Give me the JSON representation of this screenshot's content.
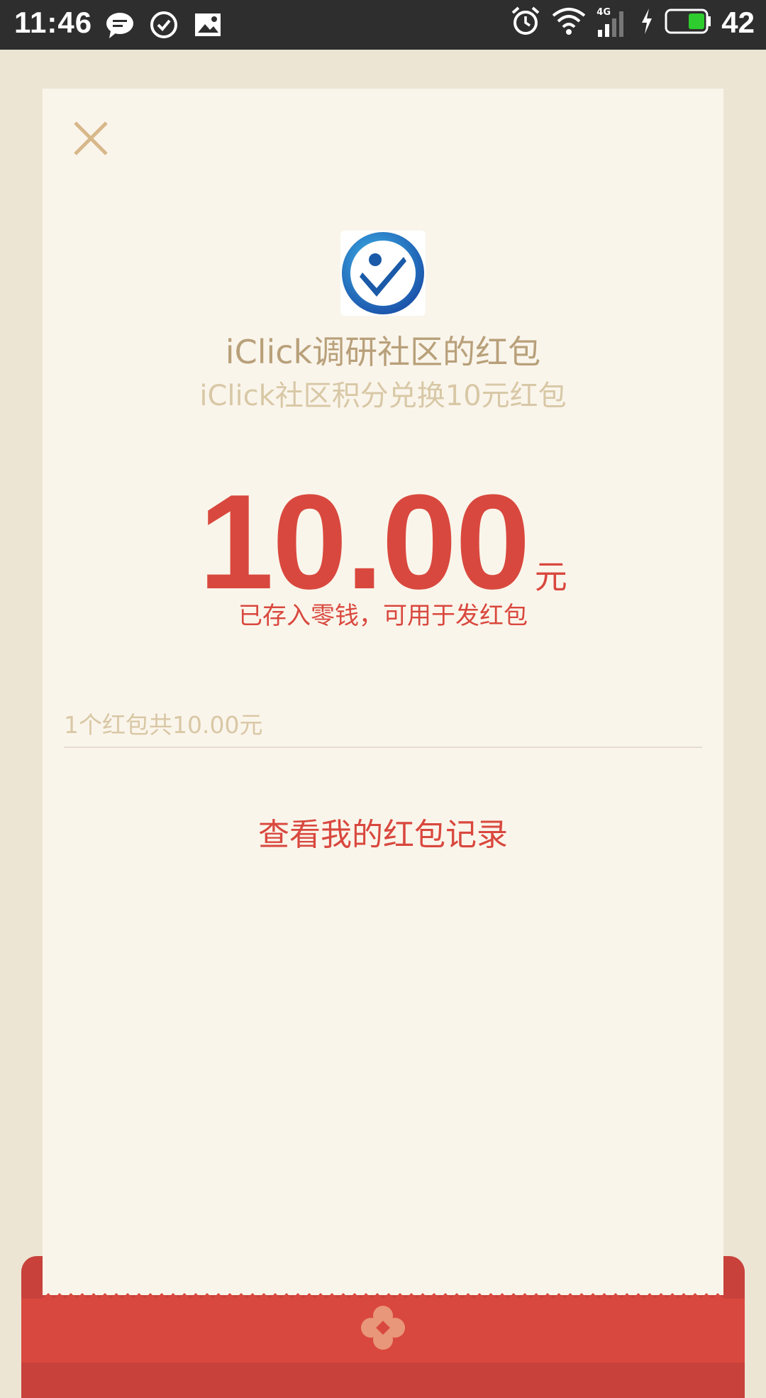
{
  "status_bar": {
    "time": "11:46",
    "left_icons": [
      "chat-bubble-icon",
      "check-circle-icon",
      "image-icon"
    ],
    "right_icons": [
      "alarm-icon",
      "wifi-icon",
      "signal-4g-icon",
      "charging-icon",
      "battery-icon"
    ],
    "network_label": "4G",
    "battery_level": "42"
  },
  "card": {
    "close_icon": "close-icon",
    "logo_icon": "iclick-check-logo",
    "title": "iClick调研社区的红包",
    "subtitle": "iClick社区积分兑换10元红包",
    "amount": "10.00",
    "unit": "元",
    "note": "已存入零钱，可用于发红包",
    "summary": "1个红包共10.00元",
    "history_link": "查看我的红包记录"
  },
  "colors": {
    "background": "#ede5d4",
    "card": "#faf5eb",
    "accent_red": "#d9483e",
    "gold_text": "#b8a07a",
    "light_gold_text": "#d8c8a6"
  }
}
